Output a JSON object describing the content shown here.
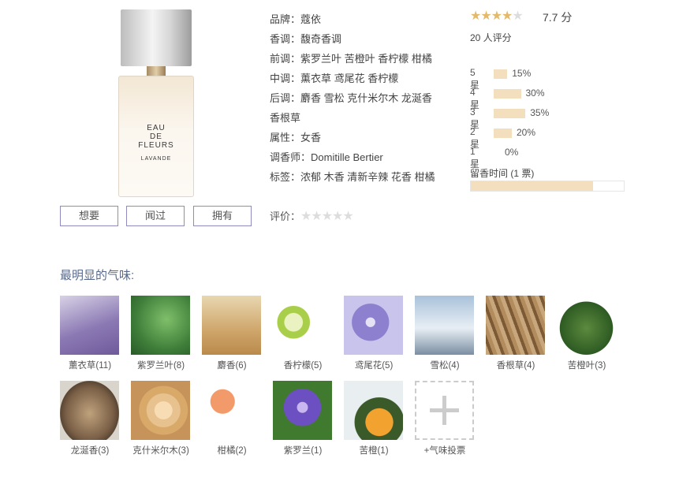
{
  "product": {
    "label_line1": "EAU",
    "label_line2": "DE",
    "label_line3": "FLEURS",
    "label_line4": "LAVANDE"
  },
  "actions": {
    "want": "想要",
    "smelled": "闻过",
    "own": "拥有"
  },
  "info": {
    "brand_key": "品牌：",
    "brand": "蔻依",
    "family_key": "香调：",
    "family": "馥奇香调",
    "top_key": "前调：",
    "top": "紫罗兰叶 苦橙叶 香柠檬 柑橘",
    "mid_key": "中调：",
    "mid": "薰衣草 鸢尾花 香柠檬",
    "base_key": "后调：",
    "base": "麝香 雪松 克什米尔木 龙涎香",
    "base_cont": "香根草",
    "attr_key": "属性：",
    "attr": "女香",
    "perfumer_key": "调香师：",
    "perfumer": "Domitille Bertier",
    "tags_key": "标签：",
    "tags": "浓郁 木香 清新辛辣 花香 柑橘"
  },
  "my_rating": {
    "label": "评价：",
    "stars": "★★★★★"
  },
  "score": {
    "stars_on": "★★★★",
    "stars_off": "★",
    "value": "7.7 分",
    "count": "20 人评分",
    "distribution": [
      {
        "label": "5星",
        "pct": "15%",
        "value": 15
      },
      {
        "label": "4星",
        "pct": "30%",
        "value": 30
      },
      {
        "label": "3星",
        "pct": "35%",
        "value": 35
      },
      {
        "label": "2星",
        "pct": "20%",
        "value": 20
      },
      {
        "label": "1星",
        "pct": "0%",
        "value": 0
      }
    ],
    "linger_title": "留香时间 (1 票)",
    "linger_fill": 0.8
  },
  "notes": {
    "title": "最明显的气味:",
    "items": [
      {
        "name": "薰衣草(11)"
      },
      {
        "name": "紫罗兰叶(8)"
      },
      {
        "name": "麝香(6)"
      },
      {
        "name": "香柠檬(5)"
      },
      {
        "name": "鸢尾花(5)"
      },
      {
        "name": "雪松(4)"
      },
      {
        "name": "香根草(4)"
      },
      {
        "name": "苦橙叶(3)"
      },
      {
        "name": "龙涎香(3)"
      },
      {
        "name": "克什米尔木(3)"
      },
      {
        "name": "柑橘(2)"
      },
      {
        "name": "紫罗兰(1)"
      },
      {
        "name": "苦橙(1)"
      }
    ],
    "add_label": "+气味投票"
  },
  "colors": {
    "accent_border": "#8f8ac0",
    "star_gold": "#e3b96a",
    "bar_fill": "#f3dfbe",
    "title_blue": "#5a6a8a"
  }
}
